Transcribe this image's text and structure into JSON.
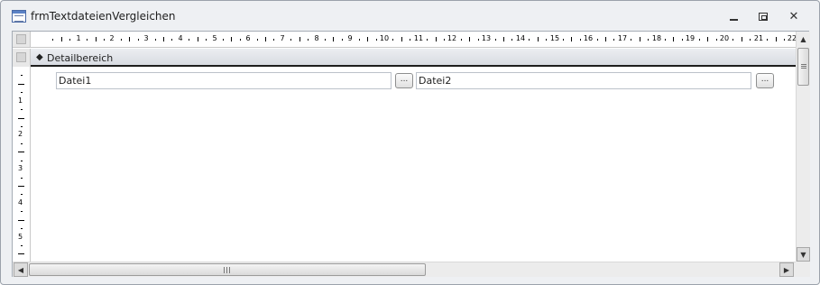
{
  "window": {
    "title": "frmTextdateienVergleichen",
    "icon": "form-icon",
    "controls": {
      "minimize": "minimize-icon",
      "restore": "restore-icon",
      "close": "✕"
    }
  },
  "ruler": {
    "horizontal_numbers": [
      "1",
      "2",
      "3",
      "4",
      "5",
      "6",
      "7",
      "8",
      "9",
      "10",
      "11",
      "12",
      "13",
      "14",
      "15",
      "16",
      "17",
      "18",
      "19",
      "20",
      "21",
      "22"
    ],
    "vertical_numbers": [
      "1",
      "2",
      "3",
      "4",
      "5"
    ]
  },
  "section": {
    "label": "Detailbereich",
    "icon": "collapse-section-icon"
  },
  "controls": {
    "textbox1": "Datei1",
    "button1": "...",
    "textbox2": "Datei2",
    "button2": "..."
  },
  "scrollbars": {
    "up_arrow": "▲",
    "down_arrow": "▼",
    "left_arrow": "◀",
    "right_arrow": "▶"
  }
}
